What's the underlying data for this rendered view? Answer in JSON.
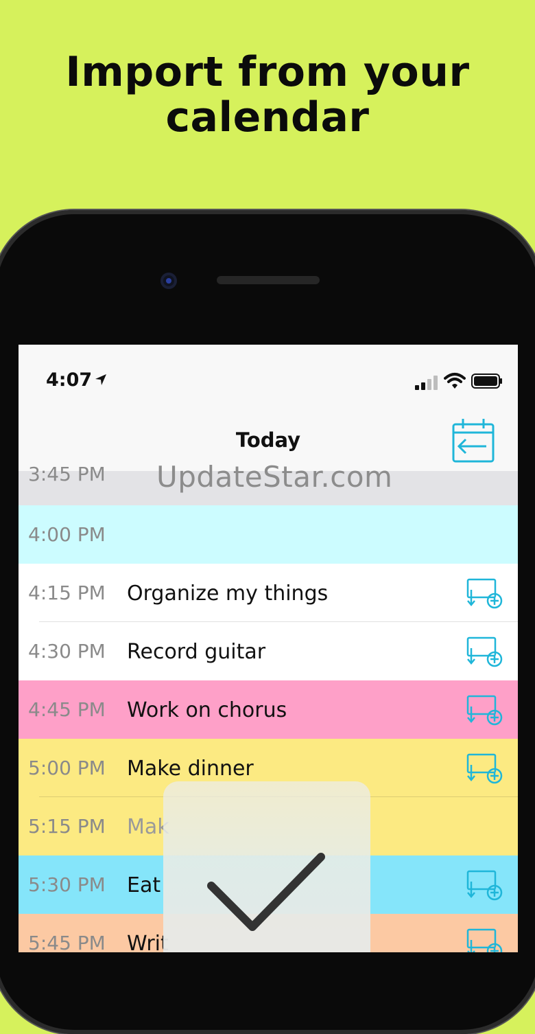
{
  "headline": {
    "line1": "Import from your",
    "line2": "calendar"
  },
  "status_bar": {
    "time": "4:07"
  },
  "nav": {
    "title": "Today"
  },
  "watermark": "UpdateStar.com",
  "colors": {
    "background": "#d6f15c",
    "accent": "#1fb6d9",
    "gray_row": "#e3e3e6",
    "cyan_row": "#ccfcff",
    "white_row": "#ffffff",
    "pink_row": "#fea0c8",
    "yellow_row": "#fcea82",
    "blue_row": "#85e5fa",
    "peach_row": "#fcc9a3"
  },
  "rows": [
    {
      "time": "3:45 PM",
      "label": "",
      "color": "#e3e3e6"
    },
    {
      "time": "4:00 PM",
      "label": "",
      "color": "#ccfcff"
    },
    {
      "time": "4:15 PM",
      "label": "Organize my things",
      "color": "#ffffff"
    },
    {
      "time": "4:30 PM",
      "label": "Record guitar",
      "color": "#ffffff"
    },
    {
      "time": "4:45 PM",
      "label": "Work on chorus",
      "color": "#fea0c8"
    },
    {
      "time": "5:00 PM",
      "label": "Make dinner",
      "color": "#fcea82"
    },
    {
      "time": "5:15 PM",
      "label": "Mak",
      "color": "#fcea82"
    },
    {
      "time": "5:30 PM",
      "label": "Eat",
      "color": "#85e5fa"
    },
    {
      "time": "5:45 PM",
      "label": "Writ",
      "color": "#fcc9a3"
    }
  ]
}
